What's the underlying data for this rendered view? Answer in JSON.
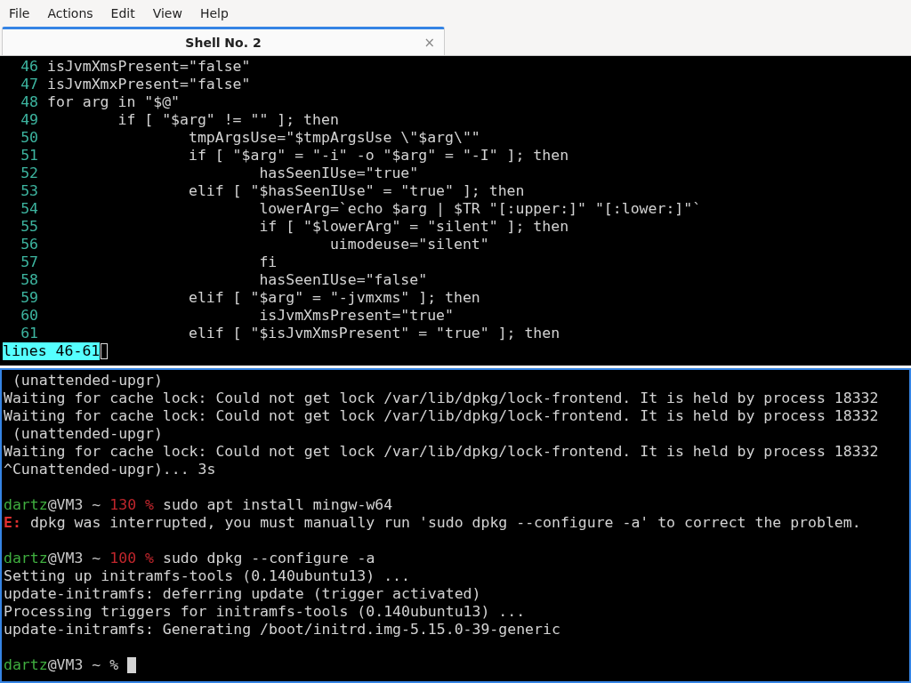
{
  "menu": [
    "File",
    "Actions",
    "Edit",
    "View",
    "Help"
  ],
  "tabs": [
    {
      "label": "Shell No. 2",
      "close": "×",
      "selected": true
    }
  ],
  "panes": [
    {
      "focused": false,
      "kind": "pager",
      "lines": [
        {
          "number": "46",
          "code": "isJvmXmsPresent=\"false\""
        },
        {
          "number": "47",
          "code": "isJvmXmxPresent=\"false\""
        },
        {
          "number": "48",
          "code": "for arg in \"$@\""
        },
        {
          "number": "49",
          "code": "\tif [ \"$arg\" != \"\" ]; then"
        },
        {
          "number": "50",
          "code": "\t\ttmpArgsUse=\"$tmpArgsUse \\\"$arg\\\"\""
        },
        {
          "number": "51",
          "code": "\t\tif [ \"$arg\" = \"-i\" -o \"$arg\" = \"-I\" ]; then"
        },
        {
          "number": "52",
          "code": "\t\t\thasSeenIUse=\"true\""
        },
        {
          "number": "53",
          "code": "\t\telif [ \"$hasSeenIUse\" = \"true\" ]; then"
        },
        {
          "number": "54",
          "code": "\t\t\tlowerArg=`echo $arg | $TR \"[:upper:]\" \"[:lower:]\"`"
        },
        {
          "number": "55",
          "code": "\t\t\tif [ \"$lowerArg\" = \"silent\" ]; then"
        },
        {
          "number": "56",
          "code": "\t\t\t\tuimodeuse=\"silent\""
        },
        {
          "number": "57",
          "code": "\t\t\tfi"
        },
        {
          "number": "58",
          "code": "\t\t\thasSeenIUse=\"false\""
        },
        {
          "number": "59",
          "code": "\t\telif [ \"$arg\" = \"-jvmxms\" ]; then"
        },
        {
          "number": "60",
          "code": "\t\t\tisJvmXmsPresent=\"true\""
        },
        {
          "number": "61",
          "code": "\t\telif [ \"$isJvmXmsPresent\" = \"true\" ]; then"
        }
      ],
      "status": "lines 46-61"
    },
    {
      "focused": true,
      "kind": "shell",
      "lines": [
        {
          "kind": "output",
          "text": " (unattended-upgr)"
        },
        {
          "kind": "output",
          "text": "Waiting for cache lock: Could not get lock /var/lib/dpkg/lock-frontend. It is held by process 18332"
        },
        {
          "kind": "output",
          "text": "Waiting for cache lock: Could not get lock /var/lib/dpkg/lock-frontend. It is held by process 18332"
        },
        {
          "kind": "output",
          "text": " (unattended-upgr)"
        },
        {
          "kind": "output",
          "text": "Waiting for cache lock: Could not get lock /var/lib/dpkg/lock-frontend. It is held by process 18332"
        },
        {
          "kind": "output",
          "text": "^Cunattended-upgr)... 3s"
        },
        {
          "kind": "blank"
        },
        {
          "kind": "prompt",
          "user": "dartz",
          "host": "@VM3 ~",
          "exit_status": "130 %",
          "command": "sudo apt install mingw-w64"
        },
        {
          "kind": "error",
          "tag": "E:",
          "text": "dpkg was interrupted, you must manually run 'sudo dpkg --configure -a' to correct the problem."
        },
        {
          "kind": "blank"
        },
        {
          "kind": "prompt",
          "user": "dartz",
          "host": "@VM3 ~",
          "exit_status": "100 %",
          "command": "sudo dpkg --configure -a"
        },
        {
          "kind": "output",
          "text": "Setting up initramfs-tools (0.140ubuntu13) ..."
        },
        {
          "kind": "output",
          "text": "update-initramfs: deferring update (trigger activated)"
        },
        {
          "kind": "output",
          "text": "Processing triggers for initramfs-tools (0.140ubuntu13) ..."
        },
        {
          "kind": "output",
          "text": "update-initramfs: Generating /boot/initrd.img-5.15.0-39-generic"
        },
        {
          "kind": "blank"
        },
        {
          "kind": "prompt",
          "user": "dartz",
          "host": "@VM3 ~",
          "symbol": "%",
          "cursor": true
        }
      ]
    }
  ]
}
